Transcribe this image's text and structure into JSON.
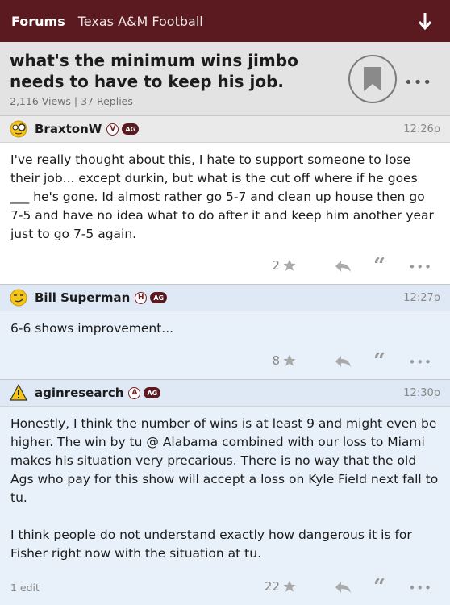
{
  "nav": {
    "forums_label": "Forums",
    "board_name": "Texas A&M Football"
  },
  "thread": {
    "title": "what's the minimum wins jimbo needs to have to keep his job.",
    "meta": "2,116 Views | 37 Replies"
  },
  "posts": [
    {
      "username": "BraxtonW",
      "badge_letter": "V",
      "badge_tag": "AG",
      "time": "12:26p",
      "avatar_icon": "monocle-face-icon",
      "body": [
        "I've really thought about this, I hate to support someone to lose their job... except durkin, but what is the cut off where if he goes ___ he's gone. Id almost rather go 5-7 and clean up house then go 7-5 and have no idea what to do after it and keep him another year just to go 7-5 again."
      ],
      "likes": "2",
      "edit_note": ""
    },
    {
      "username": "Bill Superman",
      "badge_letter": "H",
      "badge_tag": "AG",
      "time": "12:27p",
      "avatar_icon": "smirk-face-icon",
      "body": [
        "6-6 shows improvement..."
      ],
      "likes": "8",
      "edit_note": ""
    },
    {
      "username": "aginresearch",
      "badge_letter": "A",
      "badge_tag": "AG",
      "time": "12:30p",
      "avatar_icon": "warning-icon",
      "body": [
        "Honestly, I think the number of wins is at least 9 and might even be higher. The win by tu @ Alabama combined with our loss to Miami makes his situation very precarious. There is no way that the old Ags who pay for this show will accept a loss on Kyle Field next fall to tu.",
        "I think people do not understand exactly how dangerous it is for Fisher right now with the situation at tu."
      ],
      "likes": "22",
      "edit_note": "1 edit"
    }
  ],
  "colors": {
    "maroon": "#5b1a20",
    "header_gray": "#e3e3e3",
    "post_blue": "#e8f0fa"
  }
}
